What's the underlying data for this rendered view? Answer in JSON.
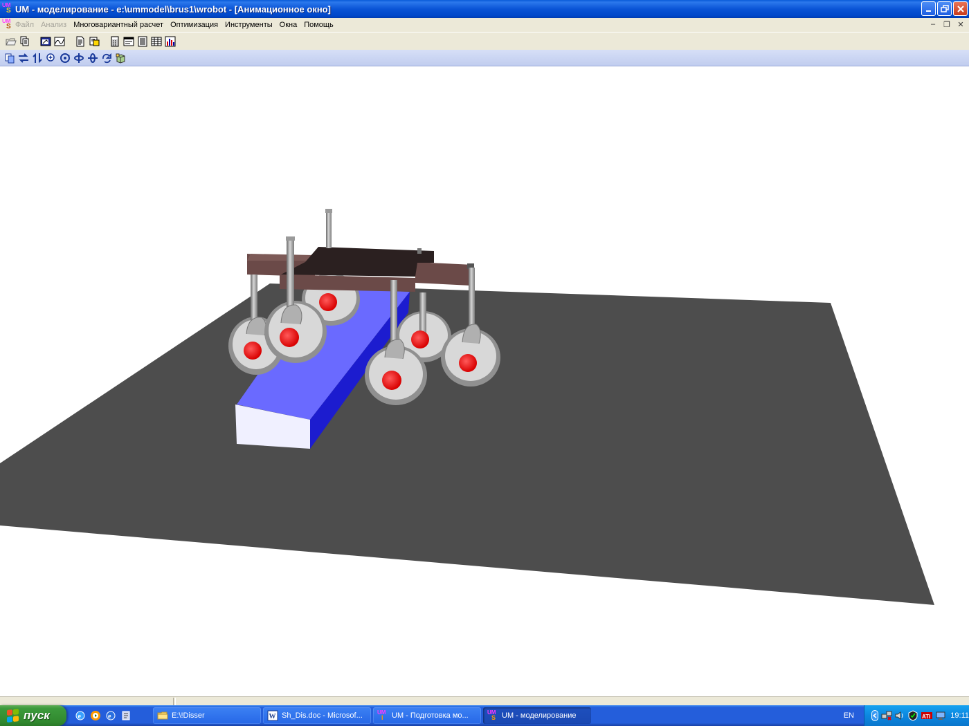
{
  "window": {
    "title": "UM - моделирование - e:\\ummodel\\brus1\\wrobot - [Анимационное окно]",
    "minimize_label": "_",
    "maximize_label": "❐",
    "close_label": "✕"
  },
  "menu": {
    "items": [
      {
        "label": "Файл",
        "enabled": false
      },
      {
        "label": "Анализ",
        "enabled": false
      },
      {
        "label": "Многовариантный расчет",
        "enabled": true
      },
      {
        "label": "Оптимизация",
        "enabled": true
      },
      {
        "label": "Инструменты",
        "enabled": true
      },
      {
        "label": "Окна",
        "enabled": true
      },
      {
        "label": "Помощь",
        "enabled": true
      }
    ],
    "mdi_minimize": "–",
    "mdi_restore": "❐",
    "mdi_close": "✕"
  },
  "toolbar1": {
    "icons": [
      "open-folder-icon",
      "copy-pages-icon",
      "animation-window-icon",
      "graph-window-icon",
      "document-icon",
      "stamp-icon",
      "calculator-icon",
      "variables-icon",
      "list-icon",
      "table-icon",
      "chart-icon"
    ]
  },
  "toolbar2": {
    "icons": [
      "copy-view-icon",
      "move-horizontal-icon",
      "move-vertical-icon",
      "zoom-icon",
      "rotate-x-icon",
      "rotate-y-icon",
      "rotate-z-icon",
      "rotate-free-icon",
      "cube-view-icon"
    ]
  },
  "scene": {
    "floor_color": "#4d4d4d",
    "beam_color": "#6b6bff",
    "beam_end_color": "#f0f0ff",
    "frame_dark_color": "#2b2020",
    "frame_light_color": "#6b4a48",
    "wheel_color": "#d8d8d8",
    "hub_color": "#ff0000",
    "leg_color": "#a0a0a0"
  },
  "taskbar": {
    "start_label": "пуск",
    "tasks": [
      {
        "label": "E:\\!Disser",
        "icon": "folder-icon",
        "active": false
      },
      {
        "label": "Sh_Dis.doc - Microsof...",
        "icon": "word-icon",
        "active": false
      },
      {
        "label": "UM - Подготовка мо...",
        "icon": "um-input-icon",
        "active": false
      },
      {
        "label": "UM - моделирование",
        "icon": "um-simulation-icon",
        "active": true
      }
    ],
    "language": "EN",
    "clock": "19:11"
  }
}
